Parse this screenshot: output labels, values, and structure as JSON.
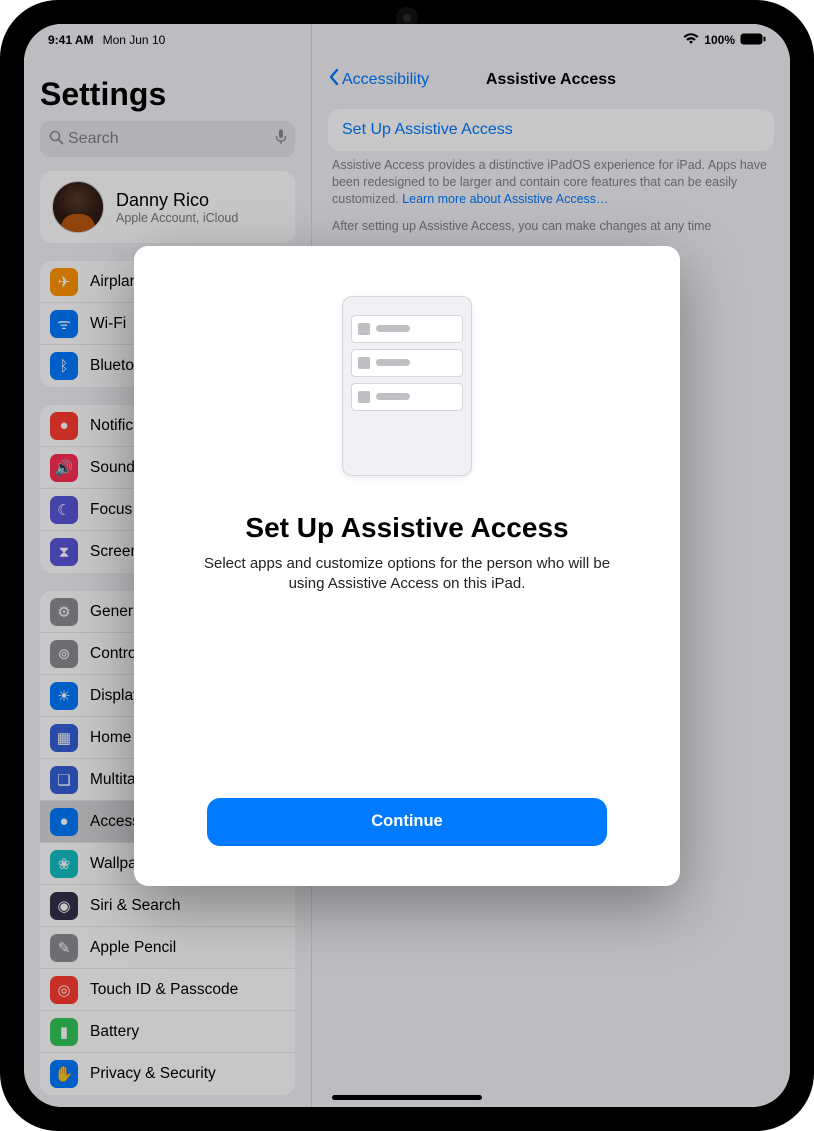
{
  "status_bar": {
    "time": "9:41 AM",
    "date": "Mon Jun 10",
    "battery": "100%"
  },
  "sidebar": {
    "title": "Settings",
    "search_placeholder": "Search",
    "profile": {
      "name": "Danny Rico",
      "subtitle": "Apple Account, iCloud"
    },
    "group1": [
      {
        "label": "Airplane Mode",
        "icon": "airplane",
        "bg": "#ff9500"
      },
      {
        "label": "Wi-Fi",
        "icon": "wifi",
        "bg": "#007aff"
      },
      {
        "label": "Bluetooth",
        "icon": "bluetooth",
        "bg": "#007aff"
      }
    ],
    "group2": [
      {
        "label": "Notifications",
        "icon": "bell",
        "bg": "#ff3b30"
      },
      {
        "label": "Sounds",
        "icon": "sound",
        "bg": "#ff2d55"
      },
      {
        "label": "Focus",
        "icon": "moon",
        "bg": "#5856d6"
      },
      {
        "label": "Screen Time",
        "icon": "hourglass",
        "bg": "#5856d6"
      }
    ],
    "group3": [
      {
        "label": "General",
        "icon": "gear",
        "bg": "#8e8e93"
      },
      {
        "label": "Control Center",
        "icon": "sliders",
        "bg": "#8e8e93"
      },
      {
        "label": "Display & Brightness",
        "icon": "sun",
        "bg": "#007aff"
      },
      {
        "label": "Home Screen & App Library",
        "icon": "grid",
        "bg": "#3561d6"
      },
      {
        "label": "Multitasking & Gestures",
        "icon": "layers",
        "bg": "#3561d6"
      },
      {
        "label": "Accessibility",
        "icon": "person",
        "bg": "#007aff",
        "selected": true
      },
      {
        "label": "Wallpaper",
        "icon": "flower",
        "bg": "#13c1c6"
      },
      {
        "label": "Siri & Search",
        "icon": "siri",
        "bg": "#31304a"
      },
      {
        "label": "Apple Pencil",
        "icon": "pencil",
        "bg": "#8e8e93"
      },
      {
        "label": "Touch ID & Passcode",
        "icon": "touchid",
        "bg": "#ff3b30"
      },
      {
        "label": "Battery",
        "icon": "battery",
        "bg": "#34c759"
      },
      {
        "label": "Privacy & Security",
        "icon": "hand",
        "bg": "#007aff"
      }
    ]
  },
  "detail": {
    "back_label": "Accessibility",
    "title": "Assistive Access",
    "setup_link": "Set Up Assistive Access",
    "desc1": "Assistive Access provides a distinctive iPadOS experience for iPad. Apps have been redesigned to be larger and contain core features that can be easily customized. ",
    "learn_link": "Learn more about Assistive Access…",
    "desc2": "After setting up Assistive Access, you can make changes at any time"
  },
  "modal": {
    "title": "Set Up Assistive Access",
    "description": "Select apps and customize options for the person who will be using Assistive Access on this iPad.",
    "button": "Continue"
  },
  "icon_glyphs": {
    "airplane": "✈",
    "wifi": "ᯤ",
    "bluetooth": "ᛒ",
    "bell": "●",
    "sound": "🔊",
    "moon": "☾",
    "hourglass": "⧗",
    "gear": "⚙",
    "sliders": "⊚",
    "sun": "☀",
    "grid": "▦",
    "layers": "❏",
    "person": "●",
    "flower": "❀",
    "siri": "◉",
    "pencil": "✎",
    "touchid": "◎",
    "battery": "▮",
    "hand": "✋"
  }
}
